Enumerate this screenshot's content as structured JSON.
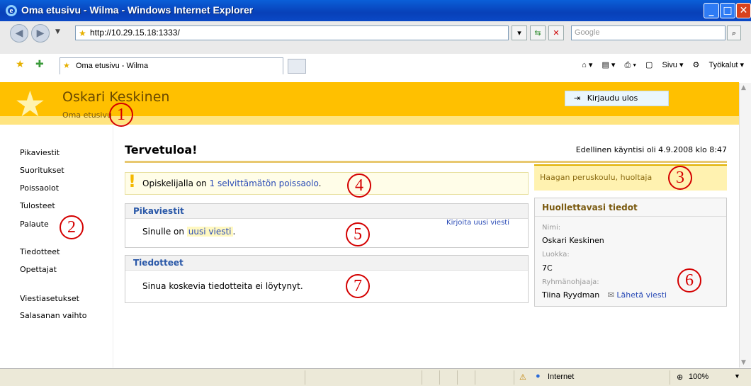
{
  "window": {
    "title": "Oma etusivu - Wilma - Windows Internet Explorer"
  },
  "browser": {
    "url": "http://10.29.15.18:1333/",
    "search_placeholder": "Google",
    "tab_title": "Oma etusivu - Wilma",
    "tools": {
      "page": "Sivu",
      "tools": "Työkalut"
    }
  },
  "header": {
    "user_name": "Oskari Keskinen",
    "breadcrumb": "Oma etusivu",
    "logout": "Kirjaudu ulos"
  },
  "sidebar": {
    "items": [
      {
        "label": "Pikaviestit"
      },
      {
        "label": "Suoritukset"
      },
      {
        "label": "Poissaolot"
      },
      {
        "label": "Tulosteet"
      },
      {
        "label": "Palaute"
      },
      {
        "label": "Tiedotteet"
      },
      {
        "label": "Opettajat"
      },
      {
        "label": "Viestiasetukset"
      },
      {
        "label": "Salasanan vaihto"
      }
    ]
  },
  "main": {
    "welcome": "Tervetuloa!",
    "last_visit": "Edellinen käyntisi oli 4.9.2008 klo 8:47",
    "alert": {
      "prefix": "Opiskelijalla on ",
      "link": "1 selvittämätön poissaolo",
      "suffix": "."
    },
    "messages": {
      "title": "Pikaviestit",
      "prefix": "Sinulle on ",
      "link": "uusi viesti",
      "suffix": ".",
      "compose": "Kirjoita uusi viesti"
    },
    "bulletins": {
      "title": "Tiedotteet",
      "text": "Sinua koskevia tiedotteita ei löytynyt."
    }
  },
  "right": {
    "school": "Haagan peruskoulu, huoltaja",
    "ward": {
      "title": "Huollettavasi tiedot",
      "name_label": "Nimi:",
      "name": "Oskari Keskinen",
      "class_label": "Luokka:",
      "class": "7C",
      "supervisor_label": "Ryhmänohjaaja:",
      "supervisor": "Tiina Ryydman",
      "send_message": "Lähetä viesti"
    }
  },
  "annotations": [
    "1",
    "2",
    "3",
    "4",
    "5",
    "6",
    "7"
  ],
  "statusbar": {
    "zone": "Internet",
    "zoom": "100%"
  }
}
